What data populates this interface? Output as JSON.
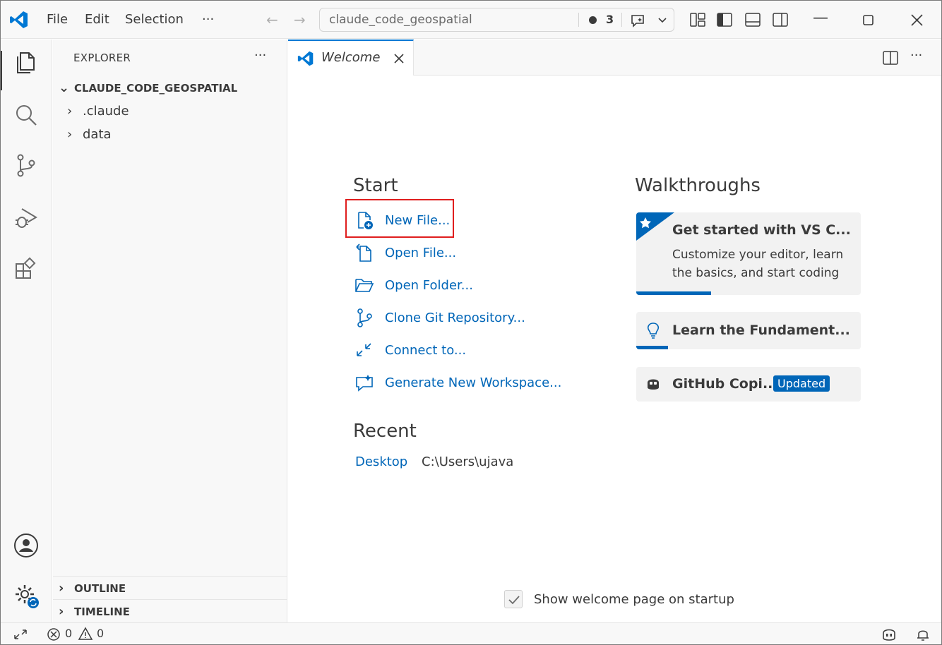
{
  "titlebar": {
    "menu": [
      "File",
      "Edit",
      "Selection",
      "···"
    ],
    "search_text": "claude_code_geospatial",
    "notification_count": "3"
  },
  "sidebar": {
    "title": "EXPLORER",
    "more": "···",
    "folder": "CLAUDE_CODE_GEOSPATIAL",
    "items": [
      ".claude",
      "data"
    ],
    "sections": [
      "OUTLINE",
      "TIMELINE"
    ]
  },
  "editor": {
    "tab_label": "Welcome",
    "start_heading": "Start",
    "start_items": [
      "New File...",
      "Open File...",
      "Open Folder...",
      "Clone Git Repository...",
      "Connect to...",
      "Generate New Workspace..."
    ],
    "walkthroughs_heading": "Walkthroughs",
    "walkthroughs": [
      {
        "title": "Get started with VS C...",
        "desc": "Customize your editor, learn the basics, and start coding"
      },
      {
        "title": "Learn the Fundament..."
      },
      {
        "title": "GitHub Copi...",
        "badge": "Updated"
      }
    ],
    "recent_heading": "Recent",
    "recent": [
      {
        "name": "Desktop",
        "path": "C:\\Users\\ujava"
      }
    ],
    "show_on_startup": "Show welcome page on startup"
  },
  "statusbar": {
    "errors": "0",
    "warnings": "0"
  },
  "colors": {
    "accent": "#0066b8",
    "highlight_box": "#e01e1e",
    "logo": "#0078d4"
  }
}
